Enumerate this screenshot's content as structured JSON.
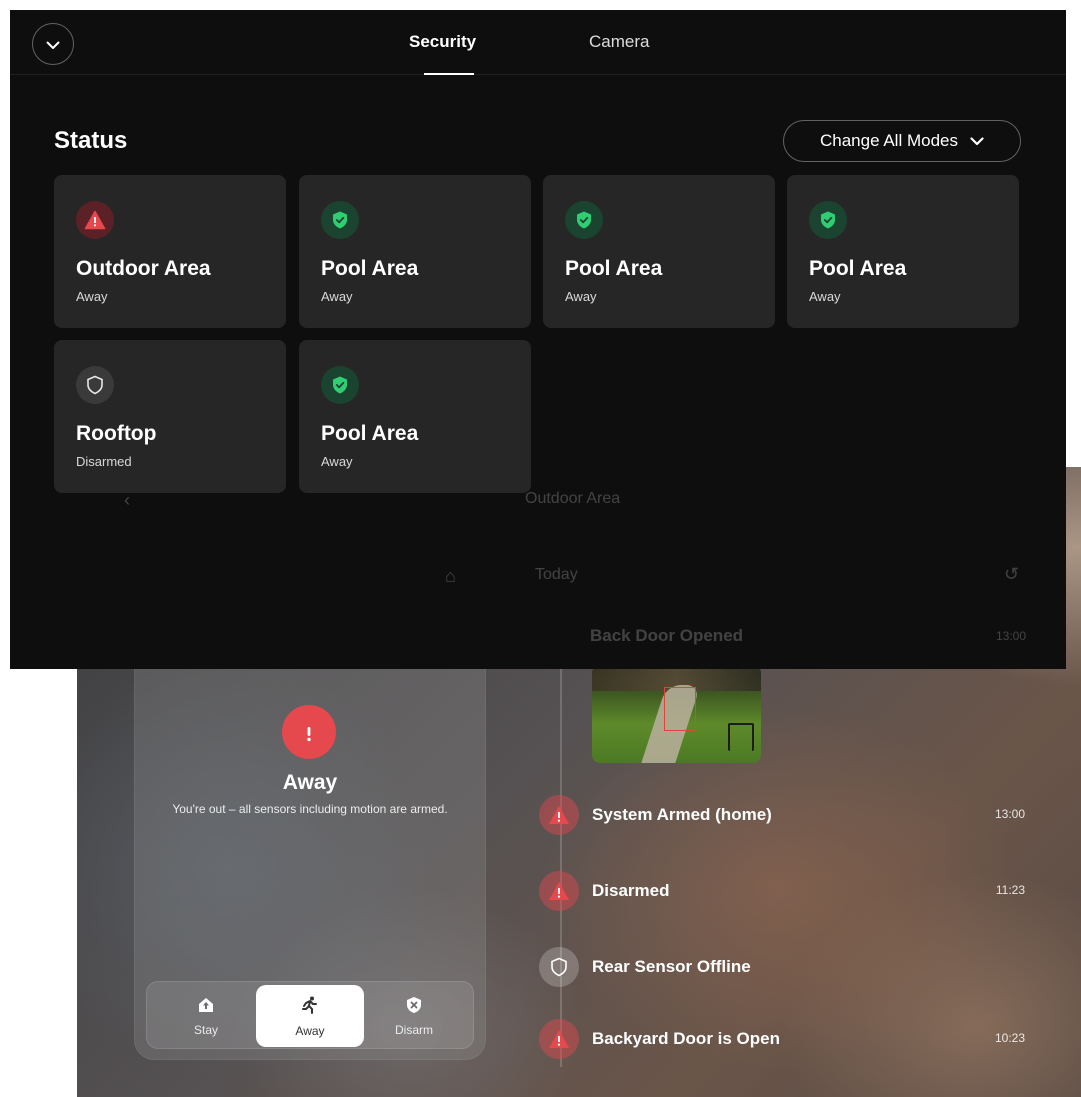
{
  "header": {
    "collapse_icon": "chevron-down-icon",
    "tabs": [
      {
        "label": "Security",
        "active": true
      },
      {
        "label": "Camera",
        "active": false
      }
    ]
  },
  "status": {
    "title": "Status",
    "change_all_label": "Change All Modes",
    "areas": [
      {
        "name": "Outdoor Area",
        "mode": "Away",
        "state": "alert",
        "icon": "warning-triangle-icon"
      },
      {
        "name": "Pool Area",
        "mode": "Away",
        "state": "ok",
        "icon": "shield-check-icon"
      },
      {
        "name": "Pool Area",
        "mode": "Away",
        "state": "ok",
        "icon": "shield-check-icon"
      },
      {
        "name": "Pool Area",
        "mode": "Away",
        "state": "ok",
        "icon": "shield-check-icon"
      },
      {
        "name": "Rooftop",
        "mode": "Disarmed",
        "state": "off",
        "icon": "shield-outline-icon"
      },
      {
        "name": "Pool Area",
        "mode": "Away",
        "state": "ok",
        "icon": "shield-check-icon"
      }
    ]
  },
  "background_view": {
    "area_title": "Outdoor Area",
    "day_label": "Today",
    "mode_card": {
      "title": "Away",
      "description": "You're out – all sensors including motion are armed.",
      "modes": [
        {
          "label": "Stay",
          "icon": "home-up-icon",
          "active": false
        },
        {
          "label": "Away",
          "icon": "running-person-icon",
          "active": true
        },
        {
          "label": "Disarm",
          "icon": "shield-x-icon",
          "active": false
        }
      ]
    },
    "events": [
      {
        "title": "Back Door Opened",
        "time": "13:00",
        "type": "alert"
      },
      {
        "title": "System Armed (home)",
        "time": "13:00",
        "type": "alert"
      },
      {
        "title": "Disarmed",
        "time": "11:23",
        "type": "alert"
      },
      {
        "title": "Rear Sensor Offline",
        "time": "",
        "type": "offline"
      },
      {
        "title": "Backyard Door is Open",
        "time": "10:23",
        "type": "alert"
      }
    ]
  },
  "colors": {
    "alert_red": "#e5484d",
    "ok_green": "#2fce73",
    "overlay_bg": "#0e0e0e",
    "card_bg": "#262626"
  }
}
